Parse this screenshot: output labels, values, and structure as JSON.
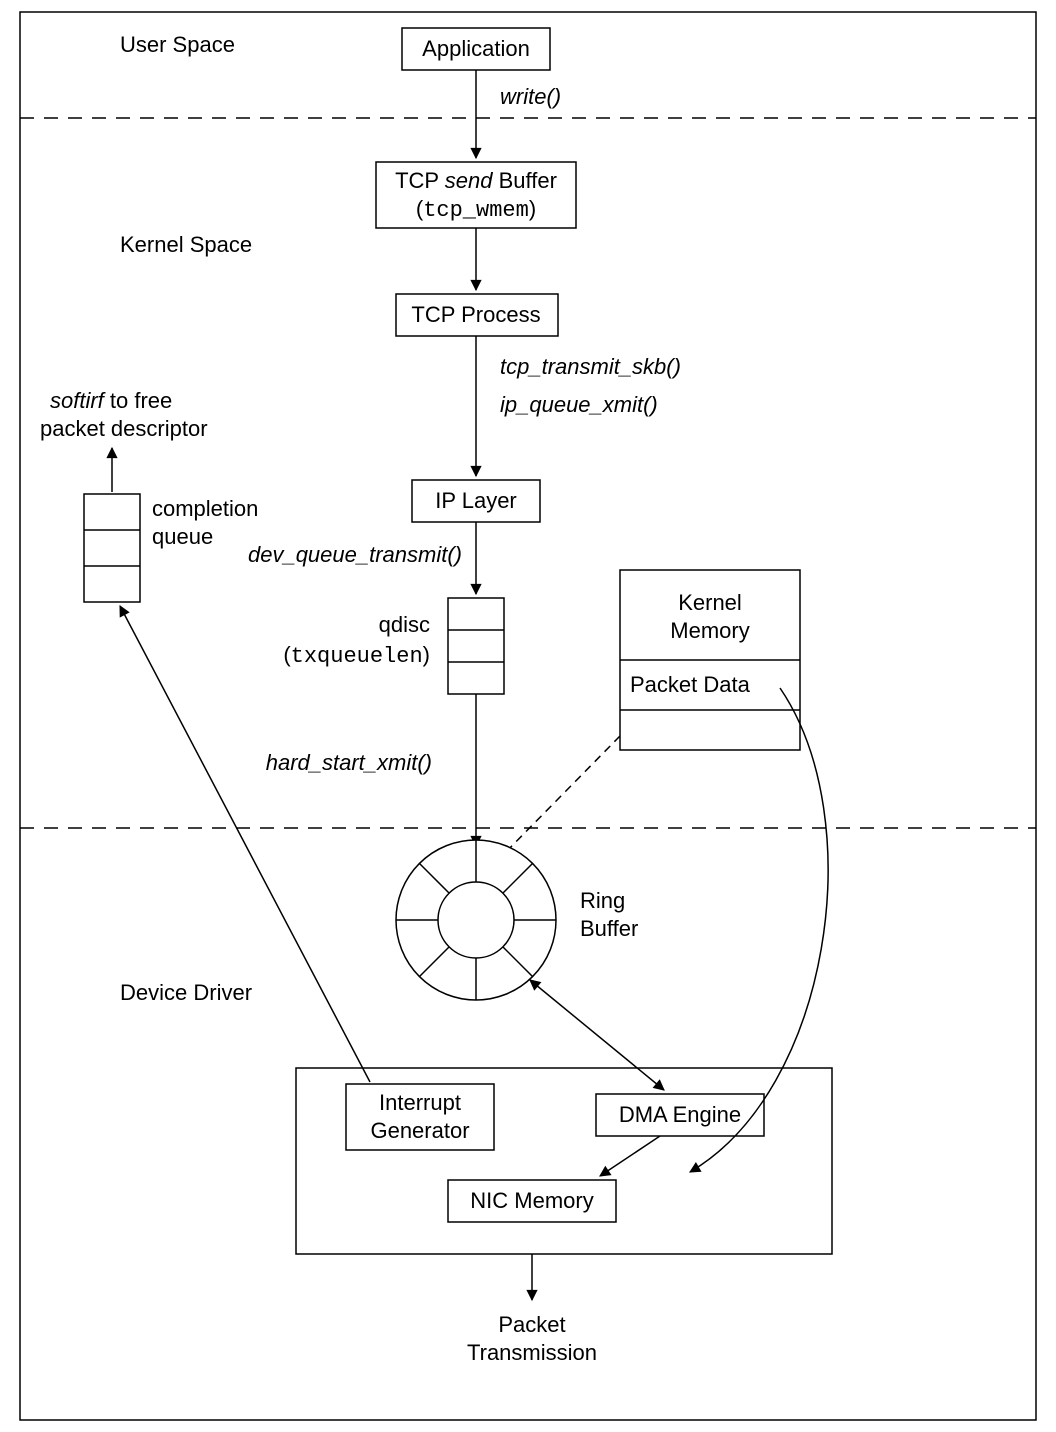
{
  "regions": {
    "user": "User Space",
    "kernel": "Kernel Space",
    "driver": "Device Driver"
  },
  "nodes": {
    "app": "Application",
    "tcpbuf_pre": "TCP ",
    "tcpbuf_ital": "send",
    "tcpbuf_post": " Buffer",
    "tcpbuf_sub": "tcp_wmem",
    "tcpproc": "TCP Process",
    "iplayer": "IP Layer",
    "qdisc1": "qdisc",
    "qdisc2": "txqueuelen",
    "ring1": "Ring",
    "ring2": "Buffer",
    "km1": "Kernel",
    "km2": "Memory",
    "pd": "Packet Data",
    "ig1": "Interrupt",
    "ig2": "Generator",
    "dma": "DMA Engine",
    "nicmem": "NIC Memory",
    "pt1": "Packet",
    "pt2": "Transmission",
    "cq1": "completion",
    "cq2": "queue",
    "si_pre": "softirf",
    "si_post": " to free",
    "si2": "packet descriptor"
  },
  "calls": {
    "write": "write()",
    "tts": "tcp_transmit_skb()",
    "iqx": "ip_queue_xmit()",
    "dqt": "dev_queue_transmit()",
    "hsx": "hard_start_xmit()"
  }
}
